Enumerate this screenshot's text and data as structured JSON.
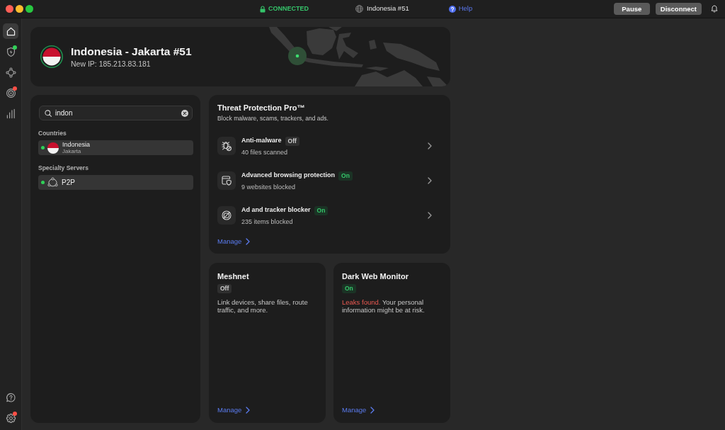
{
  "top_bar": {
    "status": "CONNECTED",
    "server": "Indonesia #51",
    "help_link": "Help",
    "buttons": [
      "Pause",
      "Disconnect"
    ]
  },
  "sidebar": {
    "items": [
      {
        "selected": true
      },
      {
        "selected": false,
        "color": "#30d158"
      },
      {
        "selected": false
      },
      {
        "selected": false,
        "color": "#ff4f46"
      },
      {
        "selected": false
      }
    ],
    "footer_items": [
      {
        "selected": false
      },
      {
        "selected": false,
        "color": "#ff4f46"
      }
    ]
  },
  "connection": {
    "server_name": "Indonesia - Jakarta #51",
    "ip": "New IP: 185.213.83.181"
  },
  "search_panel": {
    "search": {
      "value": "indon"
    },
    "groups": [
      {
        "title": "Countries",
        "items": [
          {
            "kind": "country",
            "name": "Indonesia",
            "subtitle": "Jakarta"
          }
        ]
      },
      {
        "title": "Specialty Servers",
        "items": [
          {
            "kind": "specialty",
            "name": "P2P"
          }
        ]
      }
    ]
  },
  "threat_protection": {
    "title": "Threat Protection Pro™",
    "subtitle": "Block malware, scams, trackers, and ads.",
    "features": [
      {
        "name": "Anti-malware",
        "on": false,
        "status": "Off",
        "detail": "40 files scanned"
      },
      {
        "name": "Advanced browsing protection",
        "on": true,
        "status": "On",
        "detail": "9 websites blocked"
      },
      {
        "name": "Ad and tracker blocker",
        "on": true,
        "status": "On",
        "detail": "235 items blocked"
      }
    ],
    "link": "Manage"
  },
  "cards": [
    {
      "title": "Meshnet",
      "on": false,
      "status": "Off",
      "description": "Link devices, share files, route traffic, and more.",
      "link": "Manage"
    },
    {
      "title": "Dark Web Monitor",
      "on": true,
      "status": "On",
      "alert": "Leaks found.",
      "description": "Your personal information might be at risk.",
      "link": "Manage"
    }
  ]
}
